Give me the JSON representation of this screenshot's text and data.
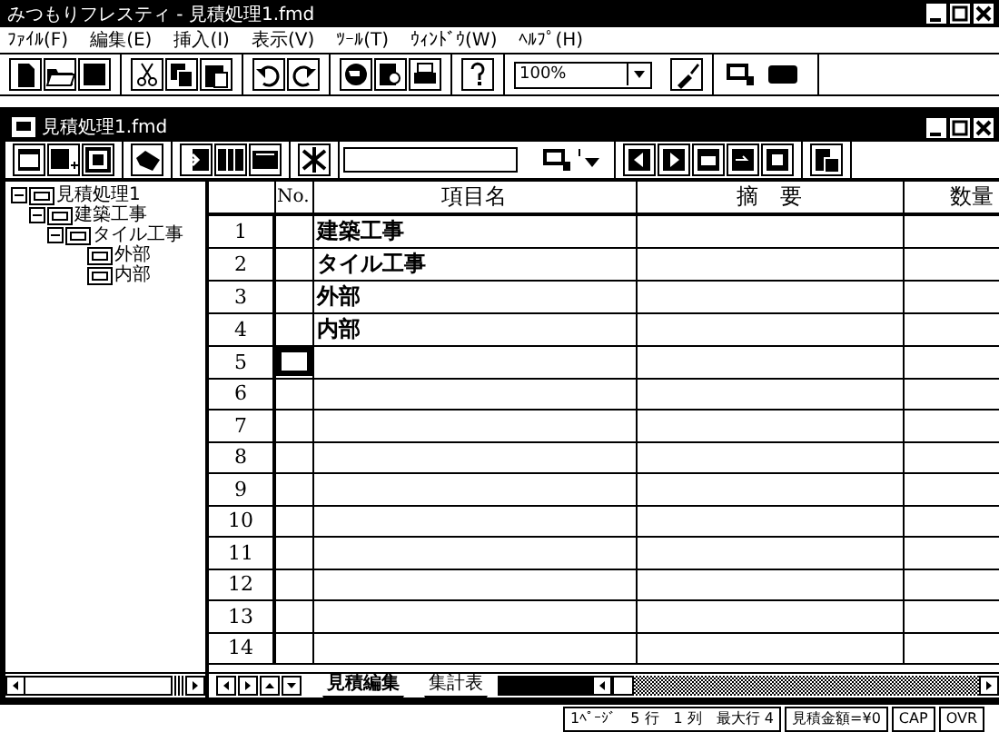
{
  "window": {
    "title": "みつもりフレスティ - 見積処理1.fmd"
  },
  "menu": [
    "ﾌｧｲﾙ(F)",
    "編集(E)",
    "挿入(I)",
    "表示(V)",
    "ﾂｰﾙ(T)",
    "ｳｨﾝﾄﾞｳ(W)",
    "ﾍﾙﾌﾟ(H)"
  ],
  "toolbar": {
    "zoom": "100%"
  },
  "document": {
    "title": "見積処理1.fmd"
  },
  "tree": [
    {
      "label": "見積処理1",
      "expanded": true,
      "children": [
        {
          "label": "建築工事",
          "expanded": true,
          "children": [
            {
              "label": "タイル工事",
              "expanded": true,
              "children": [
                {
                  "label": "外部"
                },
                {
                  "label": "内部"
                }
              ]
            }
          ]
        }
      ]
    }
  ],
  "table": {
    "columns": [
      "No.",
      "項目名",
      "摘　要",
      "数量"
    ],
    "rows": [
      {
        "number": "1",
        "name": "建築工事",
        "selected": false
      },
      {
        "number": "2",
        "name": "タイル工事",
        "selected": false
      },
      {
        "number": "3",
        "name": "外部",
        "selected": false
      },
      {
        "number": "4",
        "name": "内部",
        "selected": false
      },
      {
        "number": "5",
        "selected": true
      },
      {
        "number": "6",
        "selected": false
      },
      {
        "number": "7",
        "selected": false
      },
      {
        "number": "8",
        "selected": false
      },
      {
        "number": "9",
        "selected": false
      },
      {
        "number": "10",
        "selected": false
      },
      {
        "number": "11",
        "selected": false
      },
      {
        "number": "12",
        "selected": false
      },
      {
        "number": "13",
        "selected": false
      },
      {
        "number": "14",
        "selected": false
      }
    ]
  },
  "sheet_tabs": [
    {
      "label": "見積編集",
      "selected": true
    },
    {
      "label": "集計表",
      "selected": false
    }
  ],
  "status_bar": [
    "1ﾍﾟｰｼﾞ　5 行　1 列　最大行 4",
    "見積金額=¥0",
    "CAP",
    "OVR"
  ]
}
